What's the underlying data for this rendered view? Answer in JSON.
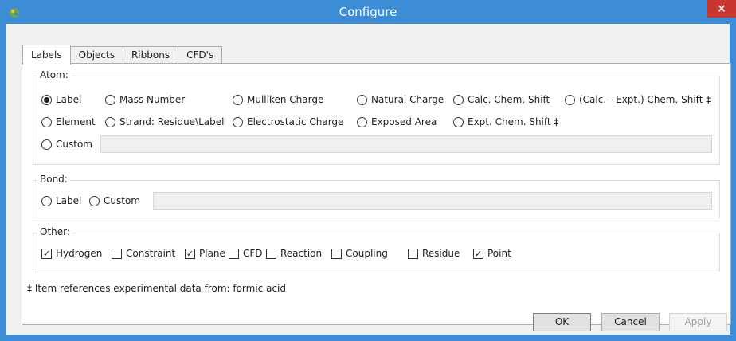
{
  "window": {
    "title": "Configure",
    "close_glyph": "×",
    "accent": "#3c8cd6"
  },
  "tabs": [
    "Labels",
    "Objects",
    "Ribbons",
    "CFD's"
  ],
  "atom": {
    "title": "Atom:",
    "options": {
      "label": "Label",
      "mass_number": "Mass Number",
      "mulliken": "Mulliken Charge",
      "natural": "Natural Charge",
      "calc_shift": "Calc. Chem. Shift",
      "calc_expt_shift": "(Calc. - Expt.) Chem. Shift ‡",
      "element": "Element",
      "strand": "Strand: Residue\\Label",
      "electrostatic": "Electrostatic Charge",
      "exposed": "Exposed Area",
      "expt_shift": "Expt. Chem. Shift ‡",
      "custom": "Custom"
    },
    "selected": "Label",
    "custom_value": ""
  },
  "bond": {
    "title": "Bond:",
    "options": {
      "label": "Label",
      "custom": "Custom"
    },
    "custom_value": ""
  },
  "other": {
    "title": "Other:",
    "items": [
      {
        "label": "Hydrogen",
        "checked": true
      },
      {
        "label": "Constraint",
        "checked": false
      },
      {
        "label": "Plane",
        "checked": true
      },
      {
        "label": "CFD",
        "checked": false
      },
      {
        "label": "Reaction",
        "checked": false
      },
      {
        "label": "Coupling",
        "checked": false
      },
      {
        "label": "Residue",
        "checked": false
      },
      {
        "label": "Point",
        "checked": true
      }
    ]
  },
  "note": "‡ Item references experimental data from: formic acid",
  "buttons": {
    "ok": "OK",
    "cancel": "Cancel",
    "apply": "Apply"
  }
}
